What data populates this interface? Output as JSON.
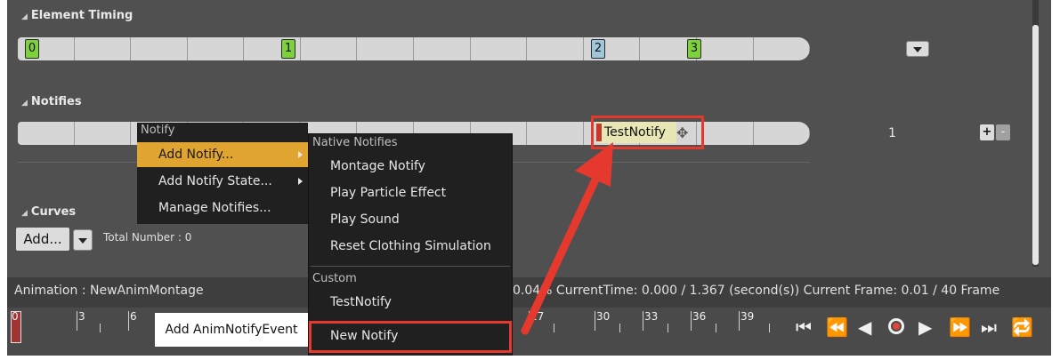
{
  "sections": {
    "element_timing": "Element Timing",
    "notifies": "Notifies",
    "curves": "Curves"
  },
  "timing_markers": [
    {
      "label": "0",
      "color": "#7dd13a"
    },
    {
      "label": "1",
      "color": "#7dd13a"
    },
    {
      "label": "2",
      "color": "#9fc7d9"
    },
    {
      "label": "3",
      "color": "#7dd13a"
    }
  ],
  "notify_track": {
    "notify_label": "TestNotify",
    "track_number": "1",
    "add_track": "+",
    "remove_track": "-"
  },
  "curves": {
    "add_button": "Add...",
    "total_number": "Total Number : 0"
  },
  "context_menu": {
    "header": "Notify",
    "items": [
      "Add Notify...",
      "Add Notify State...",
      "Manage Notifies..."
    ]
  },
  "submenu": {
    "native_header": "Native Notifies",
    "native_items": [
      "Montage Notify",
      "Play Particle Effect",
      "Play Sound",
      "Reset Clothing Simulation"
    ],
    "custom_header": "Custom",
    "custom_items": [
      "TestNotify"
    ],
    "new_notify": "New Notify"
  },
  "tooltip": "Add AnimNotifyEvent",
  "status_bar": {
    "animation": "Animation : NewAnimMontage",
    "info": "0.04% CurrentTime: 0.000 / 1.367 (second(s)) Current Frame: 0.01 / 40 Frame"
  },
  "ruler_numbers": [
    "0",
    "3",
    "6",
    "27",
    "30",
    "33",
    "36",
    "39"
  ],
  "playback_icons": [
    "skip-start-icon",
    "step-back-icon",
    "play-reverse-icon",
    "record-icon",
    "play-icon",
    "step-forward-icon",
    "skip-end-icon",
    "loop-icon"
  ],
  "colors": {
    "highlight": "#e0a431",
    "annotation_red": "#e5392e",
    "marker_green": "#7dd13a",
    "marker_blue": "#9fc7d9"
  }
}
